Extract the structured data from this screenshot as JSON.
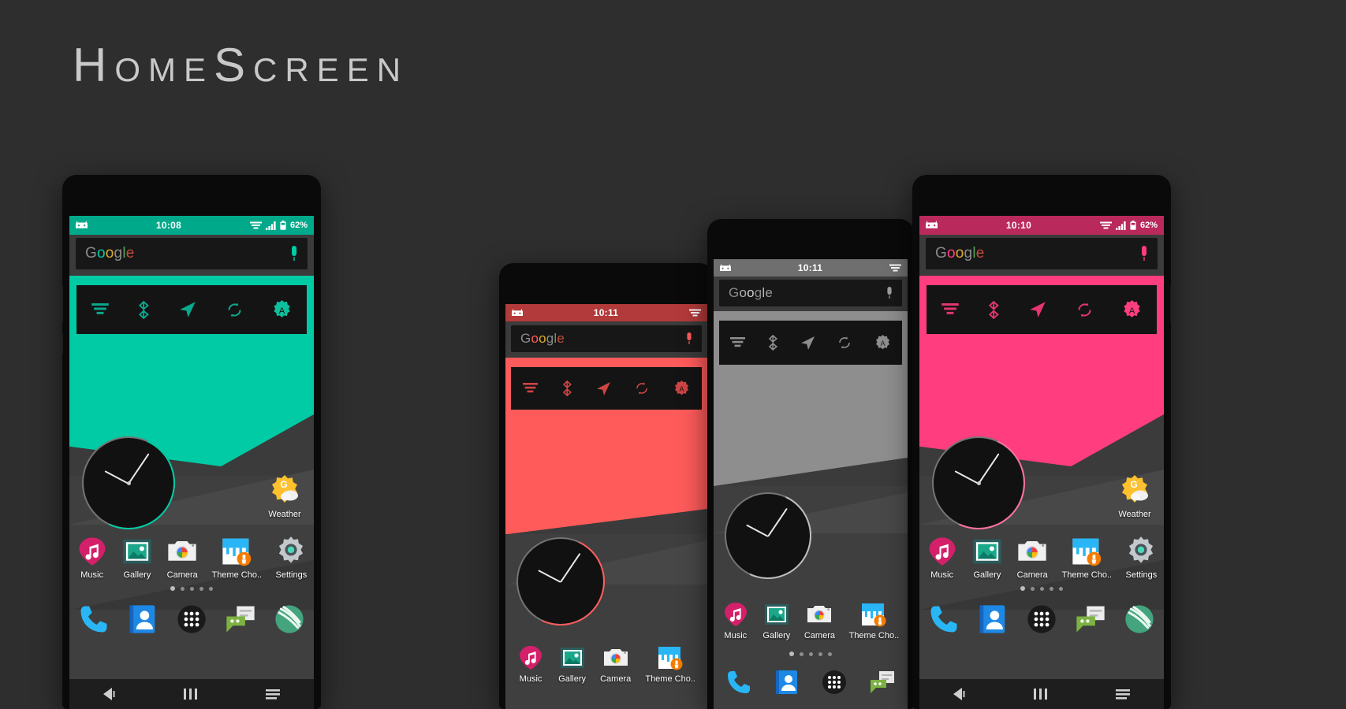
{
  "page": {
    "title": "HomeScreen",
    "background_color": "#2e2e2e"
  },
  "phones": [
    {
      "id": "phone-teal",
      "accent": "#00cba4",
      "status_accent": "#00a98a",
      "status": {
        "time": "10:08",
        "battery": "62%",
        "icons": [
          "robot-icon",
          "wifi-icon",
          "signal-icon",
          "battery-icon"
        ]
      },
      "search": {
        "google_letters": [
          "G",
          "o",
          "o",
          "g",
          "l",
          "e"
        ],
        "mic": "mic-icon"
      },
      "toggles": [
        "wifi-toggle-icon",
        "bluetooth-toggle-icon",
        "location-toggle-icon",
        "sync-toggle-icon",
        "brightness-auto-toggle-icon"
      ],
      "clock": {
        "name": "analog-clock-widget"
      },
      "weather": {
        "label": "Weather"
      },
      "apps": [
        {
          "label": "Music",
          "icon": "music-icon"
        },
        {
          "label": "Gallery",
          "icon": "gallery-icon"
        },
        {
          "label": "Camera",
          "icon": "camera-icon"
        },
        {
          "label": "Theme Cho..",
          "icon": "theme-chooser-icon"
        },
        {
          "label": "Settings",
          "icon": "settings-icon"
        }
      ],
      "page_dots": {
        "count": 5,
        "active": 1
      },
      "dock": [
        "phone-icon",
        "contacts-icon",
        "app-drawer-icon",
        "messaging-icon",
        "browser-icon"
      ],
      "nav": [
        "back-nav-icon",
        "home-nav-icon",
        "recents-nav-icon"
      ]
    },
    {
      "id": "phone-red",
      "accent": "#ff5b5b",
      "status_accent": "#b33a3a",
      "status": {
        "time": "10:11",
        "battery": "",
        "icons": [
          "robot-icon",
          "wifi-icon"
        ]
      },
      "search": {
        "google_letters": [
          "G",
          "o",
          "o",
          "g",
          "l",
          "e"
        ],
        "mic": "mic-icon"
      },
      "toggles": [
        "wifi-toggle-icon",
        "bluetooth-toggle-icon",
        "location-toggle-icon",
        "sync-toggle-icon",
        "brightness-auto-toggle-icon"
      ],
      "clock": {
        "name": "analog-clock-widget"
      },
      "apps": [
        {
          "label": "Music",
          "icon": "music-icon"
        },
        {
          "label": "Gallery",
          "icon": "gallery-icon"
        },
        {
          "label": "Camera",
          "icon": "camera-icon"
        },
        {
          "label": "Theme Cho..",
          "icon": "theme-chooser-icon"
        }
      ],
      "page_dots": {
        "count": 0,
        "active": 0
      },
      "dock": [],
      "nav": []
    },
    {
      "id": "phone-gray",
      "accent": "#8e8e8e",
      "status_accent": "#6f6f6f",
      "status": {
        "time": "10:11",
        "battery": "",
        "icons": [
          "robot-icon",
          "wifi-icon"
        ]
      },
      "search": {
        "google_letters": [
          "G",
          "o",
          "o",
          "g",
          "l",
          "e"
        ],
        "mic": "mic-icon"
      },
      "toggles": [
        "wifi-toggle-icon",
        "bluetooth-toggle-icon",
        "location-toggle-icon",
        "sync-toggle-icon",
        "brightness-auto-toggle-icon"
      ],
      "clock": {
        "name": "analog-clock-widget"
      },
      "apps": [
        {
          "label": "Music",
          "icon": "music-icon"
        },
        {
          "label": "Gallery",
          "icon": "gallery-icon"
        },
        {
          "label": "Camera",
          "icon": "camera-icon"
        },
        {
          "label": "Theme Cho..",
          "icon": "theme-chooser-icon"
        }
      ],
      "page_dots": {
        "count": 5,
        "active": 1
      },
      "dock": [
        "phone-icon",
        "contacts-icon",
        "app-drawer-icon",
        "messaging-icon"
      ],
      "nav": []
    },
    {
      "id": "phone-pink",
      "accent": "#ff3d7f",
      "status_accent": "#b9295c",
      "status": {
        "time": "10:10",
        "battery": "62%",
        "icons": [
          "robot-icon",
          "wifi-icon",
          "signal-icon",
          "battery-icon"
        ]
      },
      "search": {
        "google_letters": [
          "G",
          "o",
          "o",
          "g",
          "l",
          "e"
        ],
        "mic": "mic-icon"
      },
      "toggles": [
        "wifi-toggle-icon",
        "bluetooth-toggle-icon",
        "location-toggle-icon",
        "sync-toggle-icon",
        "brightness-auto-toggle-icon"
      ],
      "clock": {
        "name": "analog-clock-widget"
      },
      "weather": {
        "label": "Weather"
      },
      "apps": [
        {
          "label": "Music",
          "icon": "music-icon"
        },
        {
          "label": "Gallery",
          "icon": "gallery-icon"
        },
        {
          "label": "Camera",
          "icon": "camera-icon"
        },
        {
          "label": "Theme Cho..",
          "icon": "theme-chooser-icon"
        },
        {
          "label": "Settings",
          "icon": "settings-icon"
        }
      ],
      "page_dots": {
        "count": 5,
        "active": 1
      },
      "dock": [
        "phone-icon",
        "contacts-icon",
        "app-drawer-icon",
        "messaging-icon",
        "browser-icon"
      ],
      "nav": [
        "back-nav-icon",
        "home-nav-icon",
        "recents-nav-icon"
      ]
    }
  ]
}
